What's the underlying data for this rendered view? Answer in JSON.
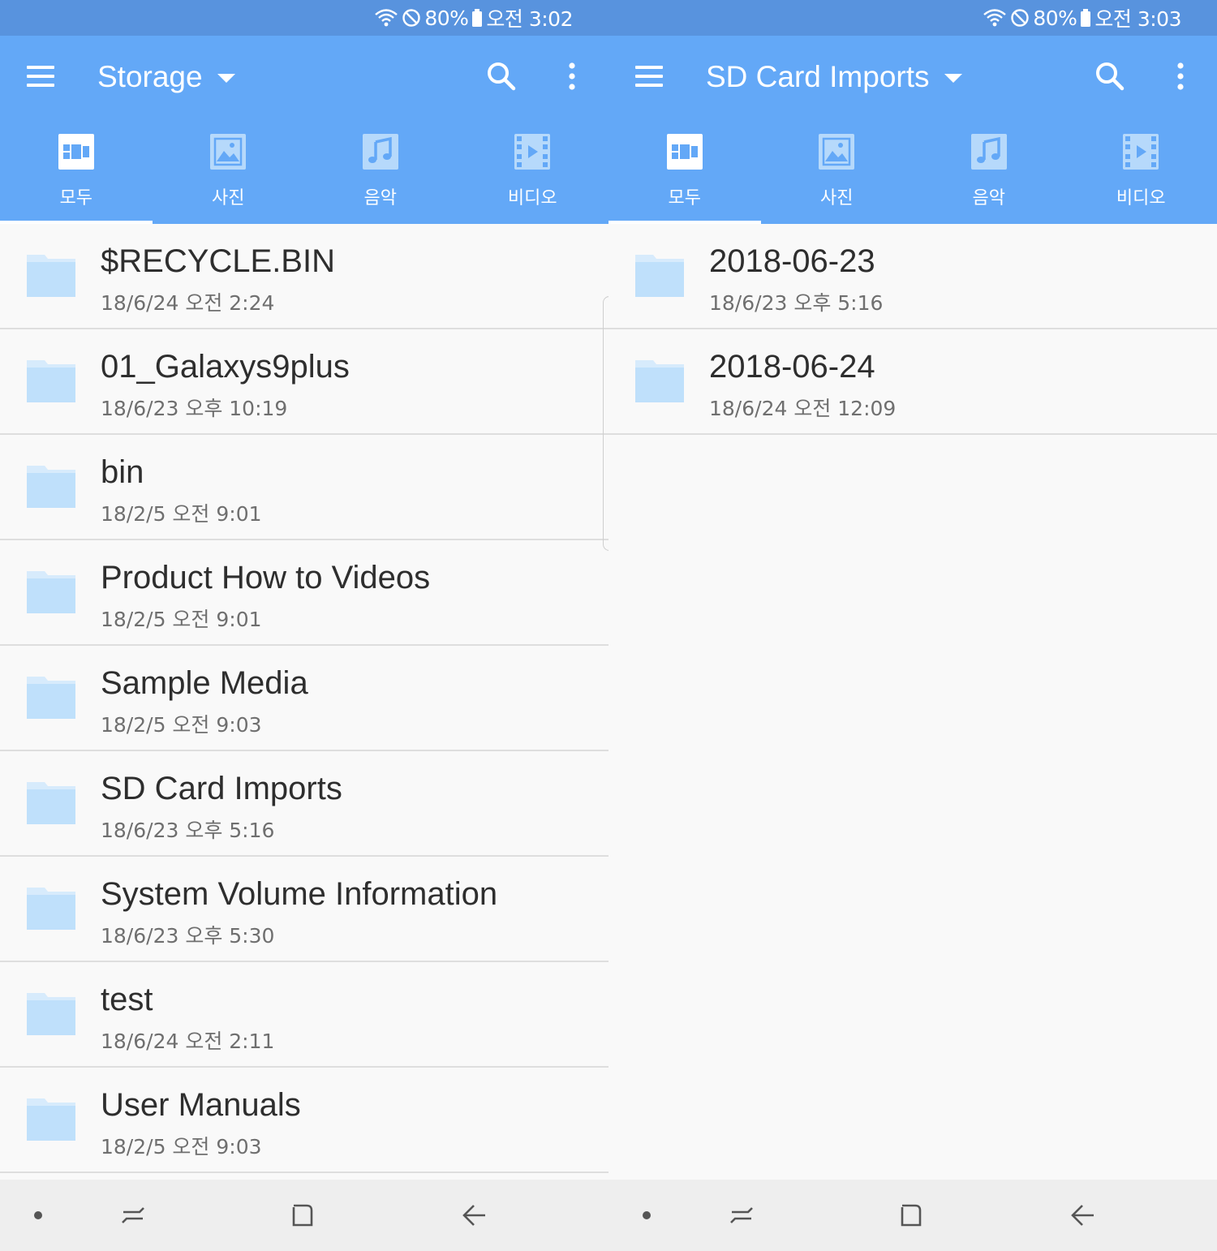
{
  "colors": {
    "status_bar": "#5893de",
    "app_bar": "#63a8f7",
    "folder": "#bfe0fb",
    "background": "#f9f9f9",
    "navbar": "#eeeeee"
  },
  "left": {
    "status": {
      "battery": "80%",
      "time": "오전 3:02"
    },
    "title": "Storage",
    "tabs": [
      {
        "label": "모두",
        "icon": "grid-icon",
        "active": true
      },
      {
        "label": "사진",
        "icon": "image-icon",
        "active": false
      },
      {
        "label": "음악",
        "icon": "music-icon",
        "active": false
      },
      {
        "label": "비디오",
        "icon": "video-icon",
        "active": false
      }
    ],
    "files": [
      {
        "name": "$RECYCLE.BIN",
        "date": "18/6/24 오전 2:24"
      },
      {
        "name": "01_Galaxys9plus",
        "date": "18/6/23 오후 10:19"
      },
      {
        "name": "bin",
        "date": "18/2/5 오전 9:01"
      },
      {
        "name": "Product How to Videos",
        "date": "18/2/5 오전 9:01"
      },
      {
        "name": "Sample Media",
        "date": "18/2/5 오전 9:03"
      },
      {
        "name": "SD Card Imports",
        "date": "18/6/23 오후 5:16"
      },
      {
        "name": "System Volume Information",
        "date": "18/6/23 오후 5:30"
      },
      {
        "name": "test",
        "date": "18/6/24 오전 2:11"
      },
      {
        "name": "User Manuals",
        "date": "18/2/5 오전 9:03"
      }
    ]
  },
  "right": {
    "status": {
      "battery": "80%",
      "time": "오전 3:03"
    },
    "title": "SD Card Imports",
    "tabs": [
      {
        "label": "모두",
        "icon": "grid-icon",
        "active": true
      },
      {
        "label": "사진",
        "icon": "image-icon",
        "active": false
      },
      {
        "label": "음악",
        "icon": "music-icon",
        "active": false
      },
      {
        "label": "비디오",
        "icon": "video-icon",
        "active": false
      }
    ],
    "files": [
      {
        "name": "2018-06-23",
        "date": "18/6/23 오후 5:16"
      },
      {
        "name": "2018-06-24",
        "date": "18/6/24 오전 12:09"
      }
    ]
  }
}
